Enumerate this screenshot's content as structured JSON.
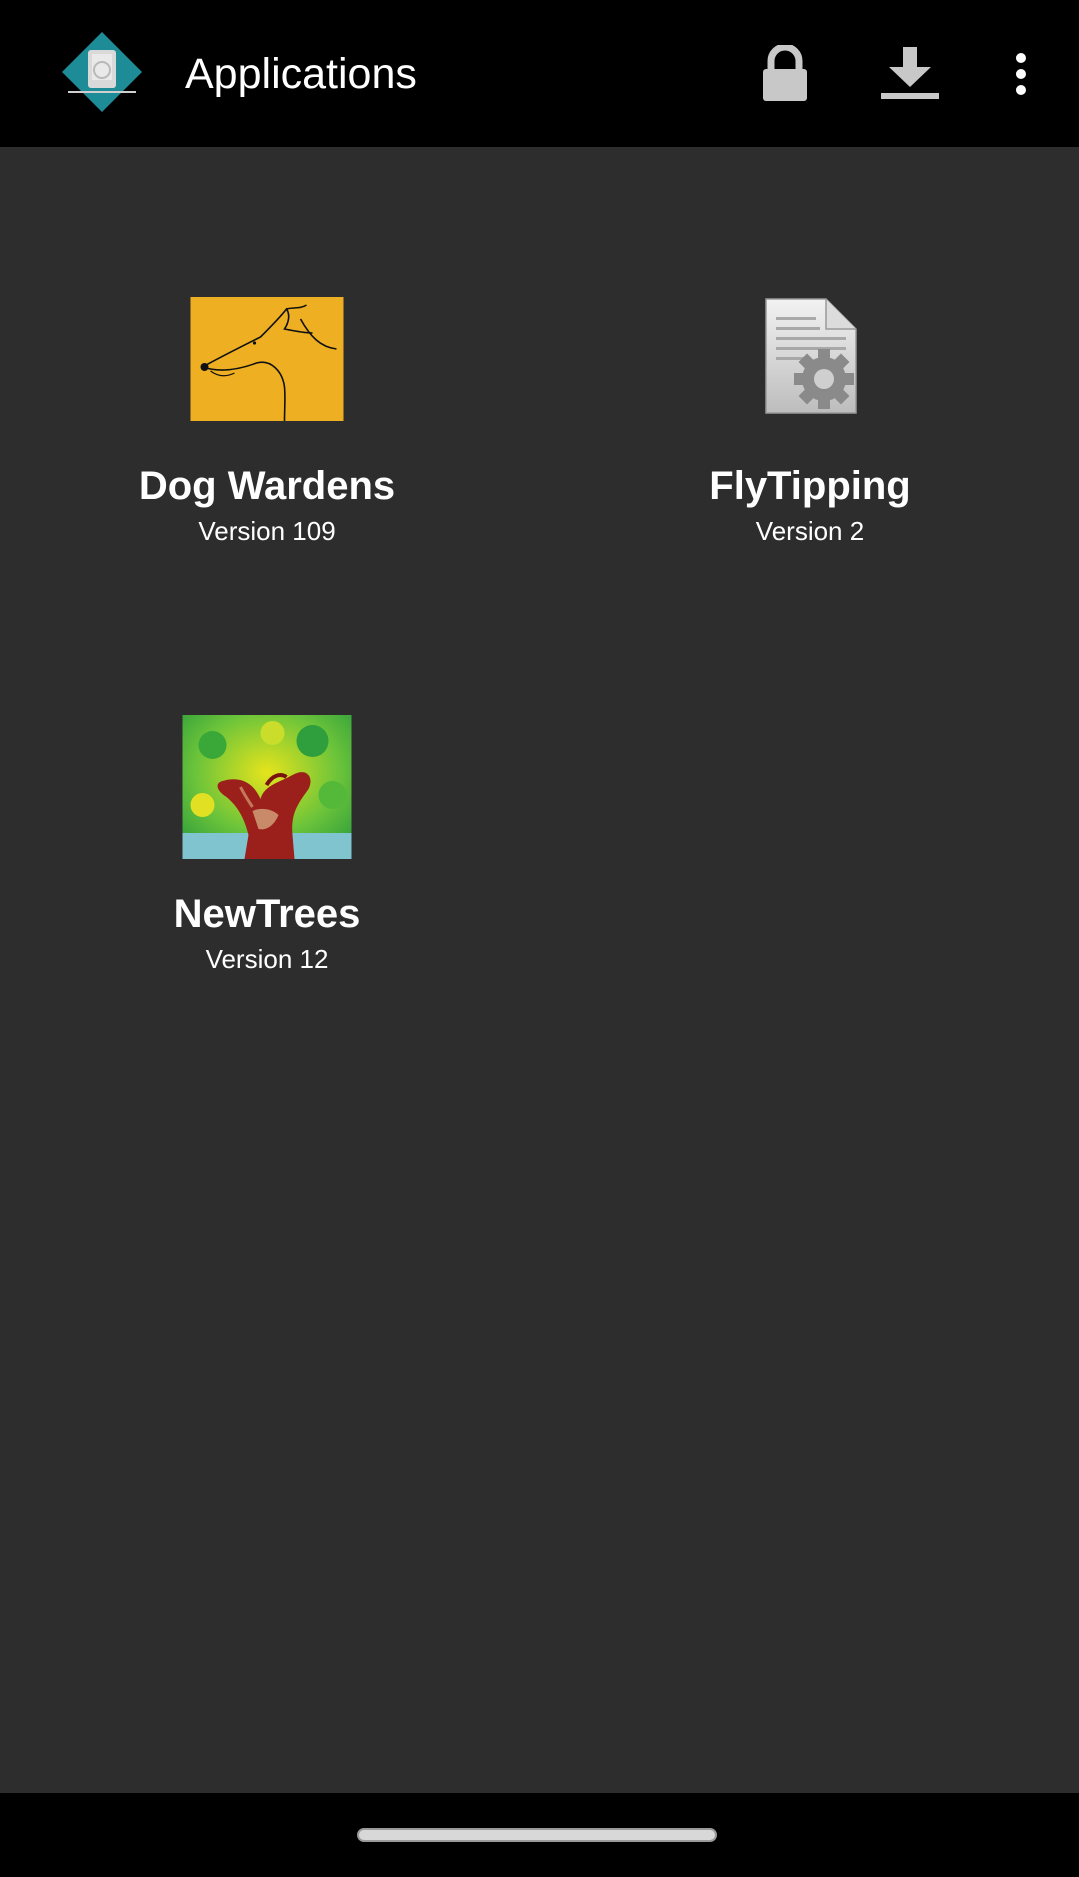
{
  "header": {
    "title": "Applications",
    "logo_icon": "app-logo-icon",
    "actions": [
      {
        "name": "lock",
        "icon": "lock-icon"
      },
      {
        "name": "download",
        "icon": "download-icon"
      },
      {
        "name": "more",
        "icon": "more-vert-icon"
      }
    ]
  },
  "apps": [
    {
      "name": "Dog Wardens",
      "version": "Version 109",
      "icon": "dog-icon"
    },
    {
      "name": "FlyTipping",
      "version": "Version 2",
      "icon": "document-gear-icon"
    },
    {
      "name": "NewTrees",
      "version": "Version 12",
      "icon": "tree-icon"
    }
  ],
  "colors": {
    "background": "#2d2d2d",
    "bar": "#000000",
    "text": "#ffffff",
    "icon_grey": "#c8c8c8",
    "logo_teal": "#1e8c96",
    "dog_bg": "#eeb022"
  }
}
